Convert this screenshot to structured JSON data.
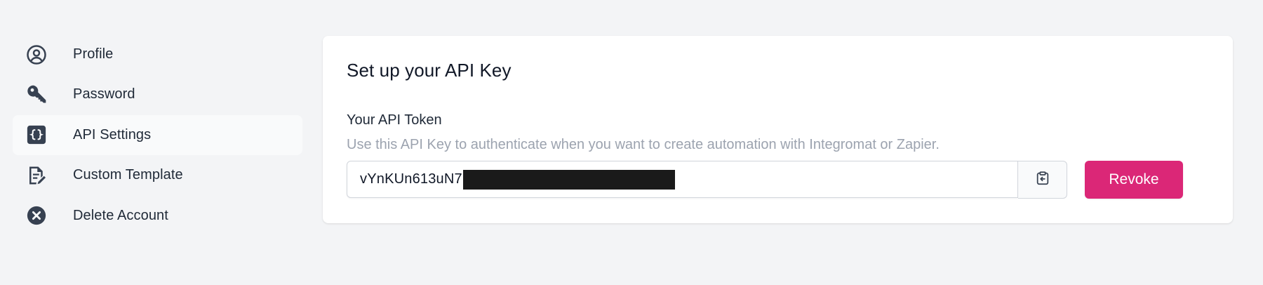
{
  "sidebar": {
    "items": [
      {
        "label": "Profile",
        "icon": "user-circle-icon",
        "active": false
      },
      {
        "label": "Password",
        "icon": "key-icon",
        "active": false
      },
      {
        "label": "API Settings",
        "icon": "code-braces-icon",
        "active": true
      },
      {
        "label": "Custom Template",
        "icon": "document-edit-icon",
        "active": false
      },
      {
        "label": "Delete Account",
        "icon": "x-circle-icon",
        "active": false
      }
    ]
  },
  "api_card": {
    "title": "Set up your API Key",
    "token_label": "Your API Token",
    "token_help": "Use this API Key to authenticate when you want to create automation with Integromat or Zapier.",
    "token_value_visible": "vYnKUn613uN7",
    "token_value_redacted": true,
    "copy_icon": "clipboard-copy-icon",
    "revoke_label": "Revoke"
  },
  "colors": {
    "page_bg": "#f3f4f6",
    "card_bg": "#ffffff",
    "accent": "#db2777",
    "icon": "#374151",
    "muted_text": "#9ca3af"
  }
}
